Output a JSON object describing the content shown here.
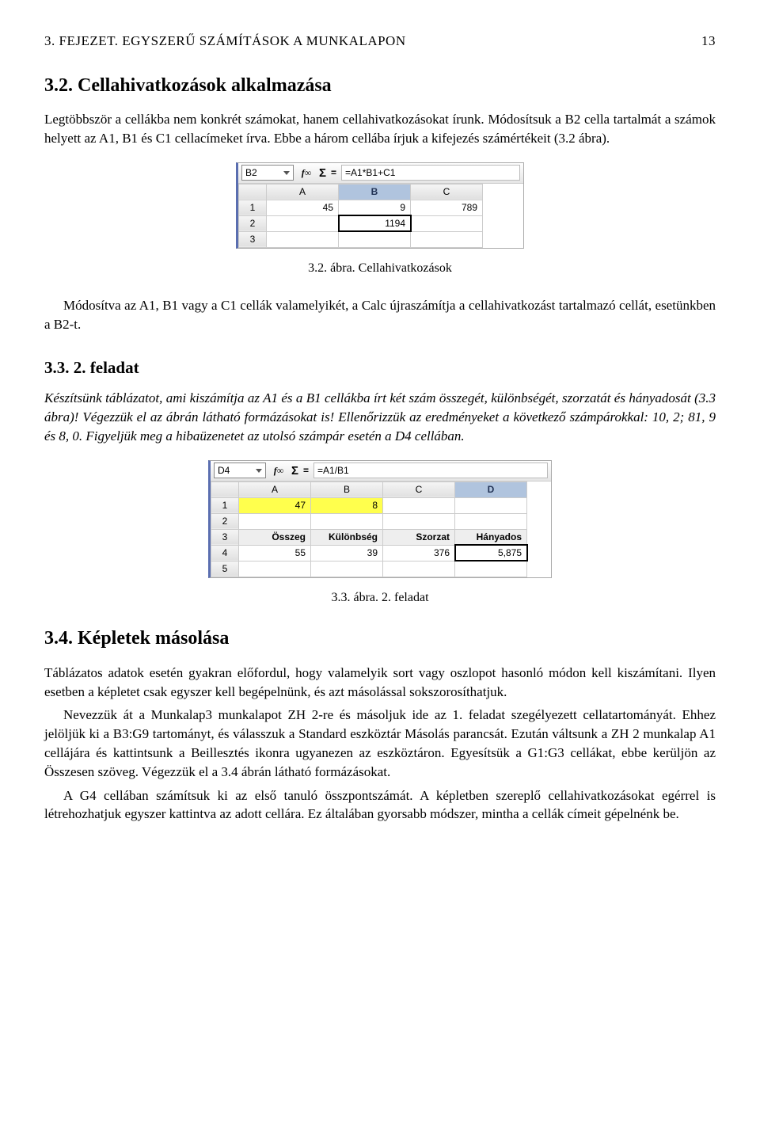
{
  "header": {
    "left": "3. FEJEZET. EGYSZERŰ SZÁMÍTÁSOK A MUNKALAPON",
    "right": "13"
  },
  "sec32": {
    "title": "3.2. Cellahivatkozások alkalmazása",
    "p1": "Legtöbbször a cellákba nem konkrét számokat, hanem cellahivatkozásokat írunk. Módosítsuk a B2 cella tartalmát a számok helyett az A1, B1 és C1 cellacímeket írva. Ebbe a három cellába írjuk a kifejezés számértékeit (3.2 ábra)."
  },
  "fig1": {
    "cellref": "B2",
    "formula": "=A1*B1+C1",
    "cols": [
      "A",
      "B",
      "C"
    ],
    "rows": [
      {
        "n": "1",
        "A": "45",
        "B": "9",
        "C": "789"
      },
      {
        "n": "2",
        "A": "",
        "B": "1194",
        "C": ""
      },
      {
        "n": "3",
        "A": "",
        "B": "",
        "C": ""
      }
    ],
    "caption": "3.2. ábra. Cellahivatkozások"
  },
  "p_after_fig1": "Módosítva az A1, B1 vagy a C1 cellák valamelyikét, a Calc újraszámítja a cellahivatkozást tartalmazó cellát, esetünkben a B2-t.",
  "sec33": {
    "title": "3.3. 2. feladat",
    "p1": "Készítsünk táblázatot, ami kiszámítja az A1 és a B1 cellákba írt két szám összegét, különbségét, szorzatát és hányadosát (3.3 ábra)! Végezzük el az ábrán látható formázásokat is! Ellenőrizzük az eredményeket a következő számpárokkal: 10, 2; 81, 9 és 8, 0. Figyeljük meg a hibaüzenetet az utolsó számpár esetén a D4 cellában."
  },
  "fig2": {
    "cellref": "D4",
    "formula": "=A1/B1",
    "cols": [
      "A",
      "B",
      "C",
      "D"
    ],
    "r1": {
      "n": "1",
      "A": "47",
      "B": "8",
      "C": "",
      "D": ""
    },
    "r2": {
      "n": "2"
    },
    "r3": {
      "n": "3",
      "A": "Összeg",
      "B": "Különbség",
      "C": "Szorzat",
      "D": "Hányados"
    },
    "r4": {
      "n": "4",
      "A": "55",
      "B": "39",
      "C": "376",
      "D": "5,875"
    },
    "r5": {
      "n": "5"
    },
    "caption": "3.3. ábra. 2. feladat"
  },
  "sec34": {
    "title": "3.4. Képletek másolása",
    "p1": "Táblázatos adatok esetén gyakran előfordul, hogy valamelyik sort vagy oszlopot hasonló módon kell kiszámítani. Ilyen esetben a képletet csak egyszer kell begépelnünk, és azt másolással sokszorosíthatjuk.",
    "p2": "Nevezzük át a Munkalap3 munkalapot ZH 2-re és másoljuk ide az 1. feladat szegélyezett cellatartományát. Ehhez jelöljük ki a B3:G9 tartományt, és válasszuk a Standard eszköztár Másolás parancsát. Ezután váltsunk a ZH 2 munkalap A1 cellájára és kattintsunk a Beillesztés ikonra ugyanezen az eszköztáron. Egyesítsük a G1:G3 cellákat, ebbe kerüljön az Összesen szöveg. Végezzük el a 3.4 ábrán látható formázásokat.",
    "p3": "A G4 cellában számítsuk ki az első tanuló összpontszámát. A képletben szereplő cellahivatkozásokat egérrel is létrehozhatjuk egyszer kattintva az adott cellára. Ez általában gyorsabb módszer, mintha a cellák címeit gépelnénk be."
  },
  "icons": {
    "fx": "f∞",
    "sigma": "Σ",
    "eq": "="
  }
}
